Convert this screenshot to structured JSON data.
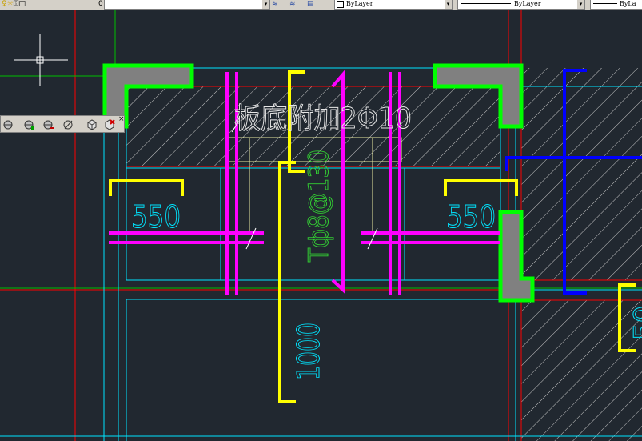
{
  "toolbar": {
    "layer_current": "0",
    "color_value": "ByLayer",
    "linetype_value": "ByLayer",
    "lineweight_value": "ByLa"
  },
  "floating_toolbar": {
    "buttons": [
      "sphere-icon",
      "sphere-add-icon",
      "sphere-remove-icon",
      "diameter-icon",
      "box-3d-icon",
      "box-delete-icon"
    ]
  },
  "drawing": {
    "note_text": "板底附加2Φ10",
    "dim_left": "550",
    "dim_right": "550",
    "dim_vertical": "1000",
    "rebar_label": "Tф8@130",
    "dim_right_partial": "50"
  },
  "colors": {
    "background": "#212830",
    "column_outline": "#00ff00",
    "column_fill": "#808080",
    "rebar": "#ff00ff",
    "dimension": "#ffff00",
    "grid_line": "#ff0000",
    "beam_line": "#00e5ff",
    "blue_rebar": "#0000ff",
    "rebar_text": "#33cc33"
  }
}
